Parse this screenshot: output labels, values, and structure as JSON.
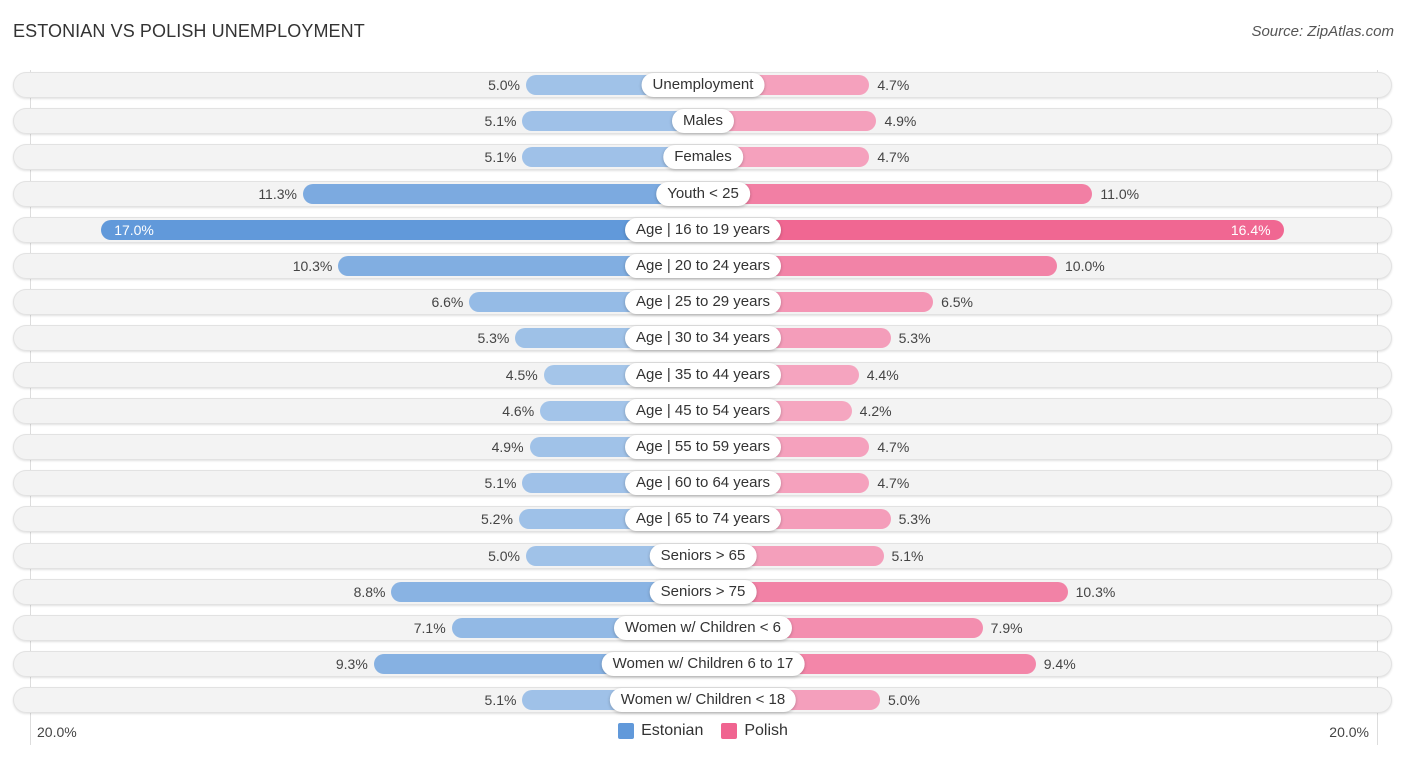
{
  "header": {
    "title": "ESTONIAN VS POLISH UNEMPLOYMENT",
    "source": "Source: ZipAtlas.com"
  },
  "colors": {
    "estonian_light": "#a9c8ea",
    "estonian_dark": "#6199da",
    "polish_light": "#f5a8c2",
    "polish_dark": "#f06490"
  },
  "chart_data": {
    "type": "bar",
    "orientation": "horizontal-diverging",
    "title": "ESTONIAN VS POLISH UNEMPLOYMENT",
    "categories": [
      "Unemployment",
      "Males",
      "Females",
      "Youth < 25",
      "Age | 16 to 19 years",
      "Age | 20 to 24 years",
      "Age | 25 to 29 years",
      "Age | 30 to 34 years",
      "Age | 35 to 44 years",
      "Age | 45 to 54 years",
      "Age | 55 to 59 years",
      "Age | 60 to 64 years",
      "Age | 65 to 74 years",
      "Seniors > 65",
      "Seniors > 75",
      "Women w/ Children < 6",
      "Women w/ Children 6 to 17",
      "Women w/ Children < 18"
    ],
    "series": [
      {
        "name": "Estonian",
        "side": "left",
        "values": [
          5.0,
          5.1,
          5.1,
          11.3,
          17.0,
          10.3,
          6.6,
          5.3,
          4.5,
          4.6,
          4.9,
          5.1,
          5.2,
          5.0,
          8.8,
          7.1,
          9.3,
          5.1
        ],
        "labels": [
          "5.0%",
          "5.1%",
          "5.1%",
          "11.3%",
          "17.0%",
          "10.3%",
          "6.6%",
          "5.3%",
          "4.5%",
          "4.6%",
          "4.9%",
          "5.1%",
          "5.2%",
          "5.0%",
          "8.8%",
          "7.1%",
          "9.3%",
          "5.1%"
        ]
      },
      {
        "name": "Polish",
        "side": "right",
        "values": [
          4.7,
          4.9,
          4.7,
          11.0,
          16.4,
          10.0,
          6.5,
          5.3,
          4.4,
          4.2,
          4.7,
          4.7,
          5.3,
          5.1,
          10.3,
          7.9,
          9.4,
          5.0
        ],
        "labels": [
          "4.7%",
          "4.9%",
          "4.7%",
          "11.0%",
          "16.4%",
          "10.0%",
          "6.5%",
          "5.3%",
          "4.4%",
          "4.2%",
          "4.7%",
          "4.7%",
          "5.3%",
          "5.1%",
          "10.3%",
          "7.9%",
          "9.4%",
          "5.0%"
        ]
      }
    ],
    "xlim": [
      -20,
      20
    ],
    "axis_labels": {
      "left": "20.0%",
      "right": "20.0%"
    },
    "unit": "%",
    "legend": {
      "position": "bottom-center",
      "entries": [
        "Estonian",
        "Polish"
      ]
    },
    "grid": false
  }
}
